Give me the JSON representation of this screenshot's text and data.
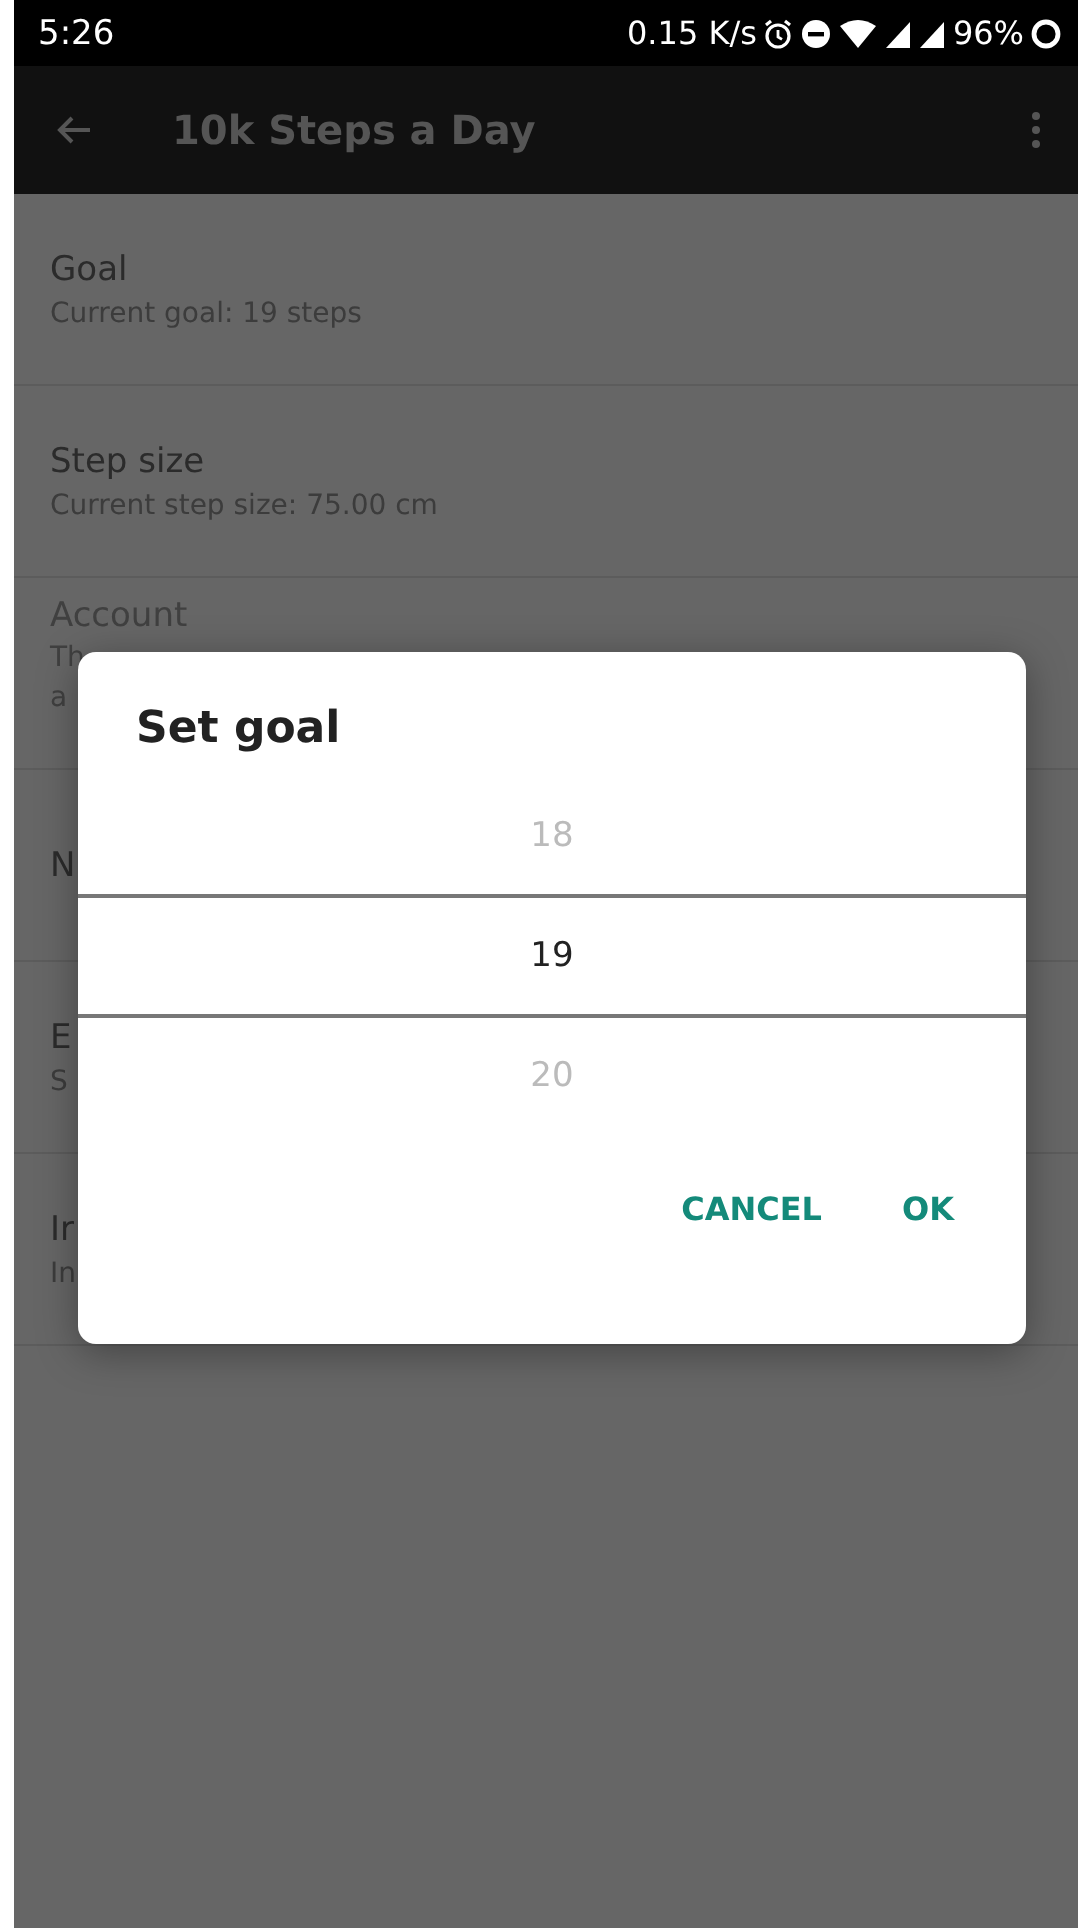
{
  "status_bar": {
    "time": "5:26",
    "speed": "0.15 K/s",
    "battery": "96%"
  },
  "app_bar": {
    "title": "10k Steps a Day"
  },
  "settings": [
    {
      "title": "Goal",
      "summary": [
        "Current goal: 19 steps"
      ],
      "disabled": false
    },
    {
      "title": "Step size",
      "summary": [
        "Current step size: 75.00 cm"
      ],
      "disabled": false
    },
    {
      "title": "Account",
      "summary": [
        "Th",
        "a"
      ],
      "disabled": true
    },
    {
      "title": "N",
      "disabled": false
    },
    {
      "title": "E",
      "summary": [
        "S"
      ],
      "disabled": false
    },
    {
      "title": "Ir",
      "summary": [
        "In"
      ],
      "disabled": false
    }
  ],
  "dialog": {
    "title": "Set goal",
    "picker": [
      {
        "value": "18",
        "selected": false
      },
      {
        "value": "19",
        "selected": true
      },
      {
        "value": "20",
        "selected": false
      }
    ],
    "buttons": [
      "CANCEL",
      "OK"
    ]
  }
}
